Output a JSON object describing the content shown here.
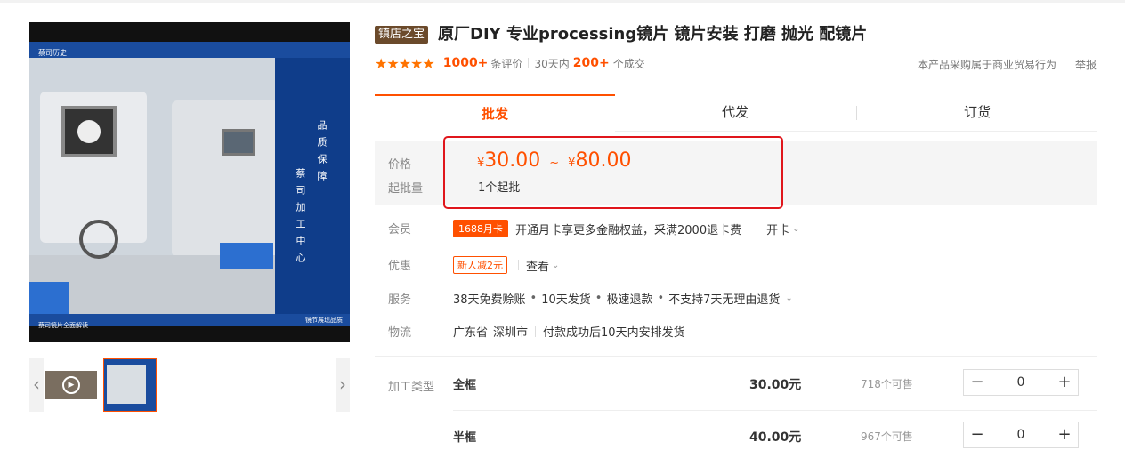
{
  "gallery": {
    "header_text": "蔡司历史",
    "footer_left": "蔡司镜片全面解读",
    "footer_right": "镜节展现品质",
    "panel_text_1": "品质保障",
    "panel_text_2": "蔡司加工中心",
    "prev_icon": "‹",
    "next_icon": "›",
    "play_icon": "▶"
  },
  "product": {
    "badge": "镇店之宝",
    "title": "原厂DIY 专业processing镜片 镜片安装 打磨 抛光 配镜片",
    "stars": "★★★★★",
    "review_count": "1000+",
    "review_label": "条评价",
    "period": "30天内",
    "sold_count": "200+",
    "sold_label": "个成交",
    "legal_note": "本产品采购属于商业贸易行为",
    "report": "举报"
  },
  "tabs": [
    {
      "label": "批发"
    },
    {
      "label": "代发"
    },
    {
      "label": "订货"
    }
  ],
  "price": {
    "label": "价格",
    "moq_label": "起批量",
    "currency": "¥",
    "min": "30.00",
    "tilde": "~",
    "max": "80.00",
    "moq": "1个起批"
  },
  "rows": {
    "member_label": "会员",
    "member_tag": "1688月卡",
    "member_text": "开通月卡享更多金融权益，采满2000退卡费",
    "member_action": "开卡",
    "discount_label": "优惠",
    "discount_tag": "新人减2元",
    "discount_action": "查看",
    "service_label": "服务",
    "service_items": [
      "38天免费赊账",
      "10天发货",
      "极速退款",
      "不支持7天无理由退货"
    ],
    "service_dot": "•",
    "logistics_label": "物流",
    "province": "广东省",
    "city": "深圳市",
    "shipping": "付款成功后10天内安排发货",
    "chevron": "⌄"
  },
  "sku": {
    "type_label": "加工类型",
    "items": [
      {
        "name": "全框",
        "price": "30.00元",
        "stock": "718个可售",
        "qty": "0"
      },
      {
        "name": "半框",
        "price": "40.00元",
        "stock": "967个可售",
        "qty": "0"
      }
    ],
    "minus": "−",
    "plus": "+"
  }
}
